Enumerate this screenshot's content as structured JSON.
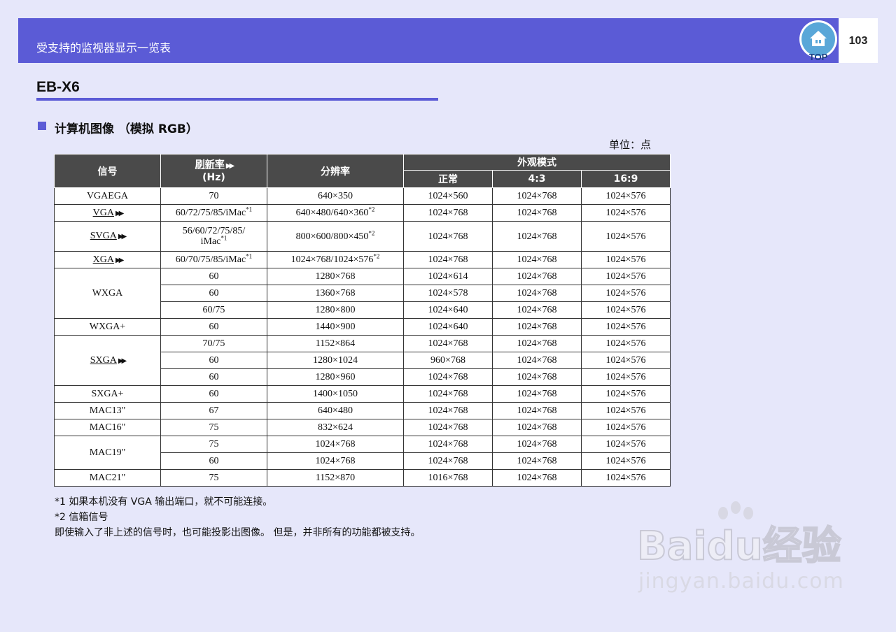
{
  "header": {
    "title": "受支持的监视器显示一览表",
    "page_number": "103",
    "top_label": "TOP"
  },
  "model": "EB-X6",
  "section_title": "计算机图像 （模拟 RGB）",
  "unit": "单位：点",
  "table": {
    "headers": {
      "signal": "信号",
      "refresh": "刷新率",
      "refresh_unit": "(Hz)",
      "resolution": "分辨率",
      "appearance": "外观模式",
      "normal": "正常",
      "ratio43": "4:3",
      "ratio169": "16:9"
    },
    "rows": [
      {
        "signal": "VGAEGA",
        "refresh": "70",
        "res": "640×350",
        "normal": "1024×560",
        "r43": "1024×768",
        "r169": "1024×576"
      },
      {
        "signal": "VGA",
        "refresh": "60/72/75/85/iMac",
        "res": "640×480/640×360",
        "normal": "1024×768",
        "r43": "1024×768",
        "r169": "1024×576"
      },
      {
        "signal": "SVGA",
        "refresh_a": "56/60/72/75/85/",
        "refresh_b": "iMac",
        "res": "800×600/800×450",
        "normal": "1024×768",
        "r43": "1024×768",
        "r169": "1024×576"
      },
      {
        "signal": "XGA",
        "refresh": "60/70/75/85/iMac",
        "res": "1024×768/1024×576",
        "normal": "1024×768",
        "r43": "1024×768",
        "r169": "1024×576"
      },
      {
        "signal": "WXGA",
        "refresh": "60",
        "res": "1280×768",
        "normal": "1024×614",
        "r43": "1024×768",
        "r169": "1024×576"
      },
      {
        "refresh": "60",
        "res": "1360×768",
        "normal": "1024×578",
        "r43": "1024×768",
        "r169": "1024×576"
      },
      {
        "refresh": "60/75",
        "res": "1280×800",
        "normal": "1024×640",
        "r43": "1024×768",
        "r169": "1024×576"
      },
      {
        "signal": "WXGA+",
        "refresh": "60",
        "res": "1440×900",
        "normal": "1024×640",
        "r43": "1024×768",
        "r169": "1024×576"
      },
      {
        "signal": "SXGA",
        "refresh": "70/75",
        "res": "1152×864",
        "normal": "1024×768",
        "r43": "1024×768",
        "r169": "1024×576"
      },
      {
        "refresh": "60",
        "res": "1280×1024",
        "normal": "960×768",
        "r43": "1024×768",
        "r169": "1024×576"
      },
      {
        "refresh": "60",
        "res": "1280×960",
        "normal": "1024×768",
        "r43": "1024×768",
        "r169": "1024×576"
      },
      {
        "signal": "SXGA+",
        "refresh": "60",
        "res": "1400×1050",
        "normal": "1024×768",
        "r43": "1024×768",
        "r169": "1024×576"
      },
      {
        "signal": "MAC13\"",
        "refresh": "67",
        "res": "640×480",
        "normal": "1024×768",
        "r43": "1024×768",
        "r169": "1024×576"
      },
      {
        "signal": "MAC16\"",
        "refresh": "75",
        "res": "832×624",
        "normal": "1024×768",
        "r43": "1024×768",
        "r169": "1024×576"
      },
      {
        "signal": "MAC19\"",
        "refresh": "75",
        "res": "1024×768",
        "normal": "1024×768",
        "r43": "1024×768",
        "r169": "1024×576"
      },
      {
        "refresh": "60",
        "res": "1024×768",
        "normal": "1024×768",
        "r43": "1024×768",
        "r169": "1024×576"
      },
      {
        "signal": "MAC21\"",
        "refresh": "75",
        "res": "1152×870",
        "normal": "1016×768",
        "r43": "1024×768",
        "r169": "1024×576"
      }
    ],
    "sup1": "*1",
    "sup2": "*2"
  },
  "notes": {
    "note1": "*1  如果本机没有 VGA 输出端口，就不可能连接。",
    "note2": "*2  信箱信号",
    "note3": "即使输入了非上述的信号时，也可能投影出图像。 但是，并非所有的功能都被支持。"
  },
  "watermark": {
    "brand": "Baidu经验",
    "url": "jingyan.baidu.com"
  },
  "colors": {
    "accent": "#5b5bd6",
    "background": "#e6e7fa",
    "table_header": "#4a4a4a"
  }
}
